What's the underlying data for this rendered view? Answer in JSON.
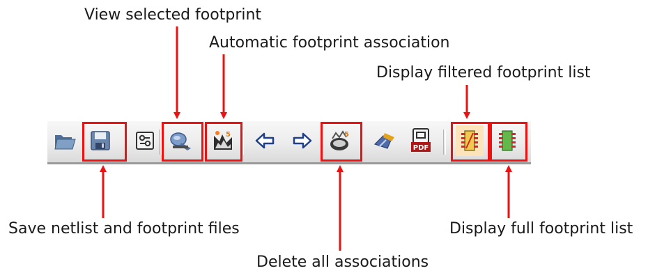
{
  "labels": {
    "view_selected": "View selected footprint",
    "auto_assoc": "Automatic footprint association",
    "display_filtered": "Display filtered footprint list",
    "save_netlist": "Save netlist and footprint files",
    "display_full": "Display full footprint list",
    "delete_all": "Delete all associations"
  },
  "toolbar": {
    "buttons": [
      {
        "id": "open",
        "icon": "folder-icon"
      },
      {
        "id": "save",
        "icon": "floppy-disk-icon"
      },
      {
        "id": "config",
        "icon": "configure-icon"
      },
      {
        "id": "view-footprint",
        "icon": "view-footprint-icon"
      },
      {
        "id": "auto-associate",
        "icon": "auto-association-icon"
      },
      {
        "id": "prev",
        "icon": "arrow-left-icon"
      },
      {
        "id": "next",
        "icon": "arrow-right-icon"
      },
      {
        "id": "delete-associations",
        "icon": "delete-associations-icon"
      },
      {
        "id": "doc",
        "icon": "documentation-icon"
      },
      {
        "id": "pdf",
        "icon": "pdf-icon",
        "text": "PDF"
      },
      {
        "id": "filtered-list",
        "icon": "filtered-list-icon"
      },
      {
        "id": "full-list",
        "icon": "full-list-icon"
      }
    ]
  },
  "colors": {
    "highlight": "#ee1111",
    "annotation_arrow": "#ee1111",
    "toolbar_bg": "#ececec"
  }
}
